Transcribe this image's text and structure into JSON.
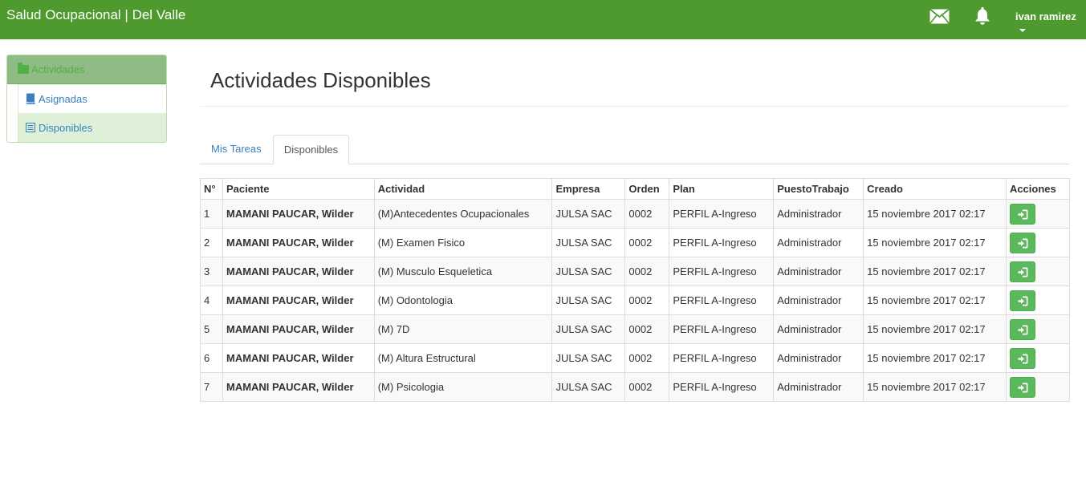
{
  "header": {
    "brand": "Salud Ocupacional | Del Valle",
    "user": "ivan ramirez",
    "icons": [
      "envelope-icon",
      "bell-icon"
    ]
  },
  "sidebar": {
    "heading": "Actividades",
    "items": [
      {
        "label": "Asignadas",
        "icon": "book-icon"
      },
      {
        "label": "Disponibles",
        "icon": "list-icon"
      }
    ]
  },
  "page": {
    "title": "Actividades Disponibles"
  },
  "tabs": [
    {
      "label": "Mis Tareas"
    },
    {
      "label": "Disponibles"
    }
  ],
  "table": {
    "headers": [
      "N°",
      "Paciente",
      "Actividad",
      "Empresa",
      "Orden",
      "Plan",
      "PuestoTrabajo",
      "Creado",
      "Acciones"
    ],
    "rows": [
      [
        "1",
        "MAMANI PAUCAR, Wilder",
        "(M)Antecedentes Ocupacionales",
        "JULSA SAC",
        "0002",
        "PERFIL A-Ingreso",
        "Administrador",
        "15 noviembre 2017 02:17"
      ],
      [
        "2",
        "MAMANI PAUCAR, Wilder",
        "(M) Examen Fisico",
        "JULSA SAC",
        "0002",
        "PERFIL A-Ingreso",
        "Administrador",
        "15 noviembre 2017 02:17"
      ],
      [
        "3",
        "MAMANI PAUCAR, Wilder",
        "(M) Musculo Esqueletica",
        "JULSA SAC",
        "0002",
        "PERFIL A-Ingreso",
        "Administrador",
        "15 noviembre 2017 02:17"
      ],
      [
        "4",
        "MAMANI PAUCAR, Wilder",
        "(M) Odontologia",
        "JULSA SAC",
        "0002",
        "PERFIL A-Ingreso",
        "Administrador",
        "15 noviembre 2017 02:17"
      ],
      [
        "5",
        "MAMANI PAUCAR, Wilder",
        "(M) 7D",
        "JULSA SAC",
        "0002",
        "PERFIL A-Ingreso",
        "Administrador",
        "15 noviembre 2017 02:17"
      ],
      [
        "6",
        "MAMANI PAUCAR, Wilder",
        "(M) Altura Estructural",
        "JULSA SAC",
        "0002",
        "PERFIL A-Ingreso",
        "Administrador",
        "15 noviembre 2017 02:17"
      ],
      [
        "7",
        "MAMANI PAUCAR, Wilder",
        "(M) Psicologia",
        "JULSA SAC",
        "0002",
        "PERFIL A-Ingreso",
        "Administrador",
        "15 noviembre 2017 02:17"
      ]
    ],
    "action_icon": "sign-in-icon"
  },
  "colors": {
    "navbar": "#4e9a2f",
    "accent_green": "#5cb85c",
    "link_blue": "#3a7fc0",
    "sidebar_active": "#dff0d8"
  }
}
